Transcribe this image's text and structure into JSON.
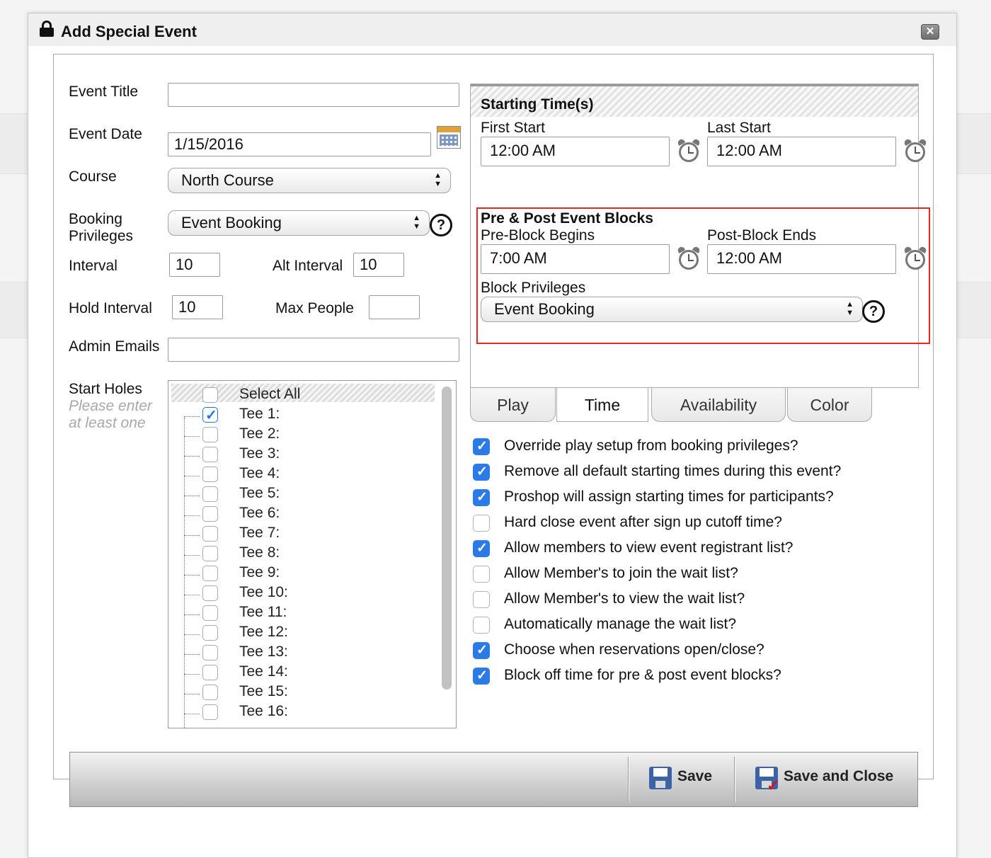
{
  "dialog": {
    "title": "Add Special Event",
    "close_label": "✕"
  },
  "form": {
    "event_title_label": "Event Title",
    "event_title_value": "",
    "event_date_label": "Event Date",
    "event_date_value": "1/15/2016",
    "course_label": "Course",
    "course_value": "North Course",
    "booking_privileges_label_line1": "Booking",
    "booking_privileges_label_line2": "Privileges",
    "booking_privileges_value": "Event Booking",
    "interval_label": "Interval",
    "interval_value": "10",
    "alt_interval_label": "Alt Interval",
    "alt_interval_value": "10",
    "hold_interval_label": "Hold Interval",
    "hold_interval_value": "10",
    "max_people_label": "Max People",
    "max_people_value": "",
    "admin_emails_label": "Admin Emails",
    "admin_emails_value": "",
    "start_holes_label": "Start Holes",
    "start_holes_hint_line1": "Please enter",
    "start_holes_hint_line2": "at least one",
    "select_all_label": "Select All",
    "holes": [
      {
        "label": "Tee 1:",
        "checked": true
      },
      {
        "label": "Tee 2:",
        "checked": false
      },
      {
        "label": "Tee 3:",
        "checked": false
      },
      {
        "label": "Tee 4:",
        "checked": false
      },
      {
        "label": "Tee 5:",
        "checked": false
      },
      {
        "label": "Tee 6:",
        "checked": false
      },
      {
        "label": "Tee 7:",
        "checked": false
      },
      {
        "label": "Tee 8:",
        "checked": false
      },
      {
        "label": "Tee 9:",
        "checked": false
      },
      {
        "label": "Tee 10:",
        "checked": false
      },
      {
        "label": "Tee 11:",
        "checked": false
      },
      {
        "label": "Tee 12:",
        "checked": false
      },
      {
        "label": "Tee 13:",
        "checked": false
      },
      {
        "label": "Tee 14:",
        "checked": false
      },
      {
        "label": "Tee 15:",
        "checked": false
      },
      {
        "label": "Tee 16:",
        "checked": false
      }
    ]
  },
  "time_panel": {
    "title": "Starting Time(s)",
    "first_start_label": "First Start",
    "first_start_value": "12:00 AM",
    "last_start_label": "Last Start",
    "last_start_value": "12:00 AM",
    "blocks_title": "Pre & Post Event Blocks",
    "pre_block_label": "Pre-Block Begins",
    "pre_block_value": "7:00 AM",
    "post_block_label": "Post-Block Ends",
    "post_block_value": "12:00 AM",
    "block_privileges_label": "Block Privileges",
    "block_privileges_value": "Event Booking"
  },
  "tabs": [
    {
      "label": "Play",
      "active": false
    },
    {
      "label": "Time",
      "active": true
    },
    {
      "label": "Availability",
      "active": false
    },
    {
      "label": "Color",
      "active": false
    }
  ],
  "options": [
    {
      "label": "Override play setup from booking privileges?",
      "checked": true
    },
    {
      "label": "Remove all default starting times during this event?",
      "checked": true
    },
    {
      "label": "Proshop will assign starting times for participants?",
      "checked": true
    },
    {
      "label": "Hard close event after sign up cutoff time?",
      "checked": false
    },
    {
      "label": "Allow members to view event registrant list?",
      "checked": true
    },
    {
      "label": "Allow Member's to join the wait list?",
      "checked": false
    },
    {
      "label": "Allow Member's to view the wait list?",
      "checked": false
    },
    {
      "label": "Automatically manage the wait list?",
      "checked": false
    },
    {
      "label": "Choose when reservations open/close?",
      "checked": true
    },
    {
      "label": "Block off time for pre & post event blocks?",
      "checked": true
    }
  ],
  "footer": {
    "save_label": "Save",
    "save_close_label": "Save and Close"
  },
  "colors": {
    "highlight": "#e8281e",
    "checkbox_checked": "#2a7ae8"
  }
}
